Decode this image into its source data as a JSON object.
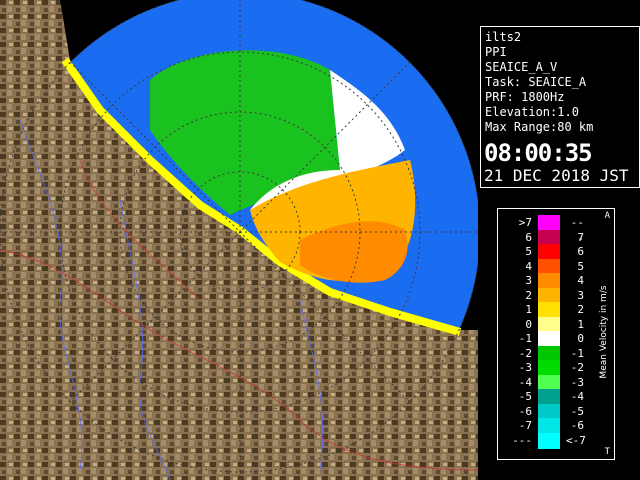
{
  "info": {
    "line1": "ilts2",
    "line2": "PPI",
    "line3": "SEAICE_A_V",
    "line4": "Task: SEAICE_A",
    "line5": "PRF: 1800Hz",
    "line6": "Elevation:1.0",
    "line7": "Max Range:80 km",
    "time": "08:00:35",
    "date": "21 DEC 2018 JST"
  },
  "legend": {
    "title": "Mean Velocity in m/s",
    "corner_top": "A",
    "corner_bottom": "T",
    "rows": [
      {
        "left": ">7",
        "right": "---",
        "color": "#ff00ff"
      },
      {
        "left": "6",
        "right": "7",
        "color": "#c80050"
      },
      {
        "left": "5",
        "right": "6",
        "color": "#ff0000"
      },
      {
        "left": "4",
        "right": "5",
        "color": "#ff5000"
      },
      {
        "left": "3",
        "right": "4",
        "color": "#ff8c00"
      },
      {
        "left": "2",
        "right": "3",
        "color": "#ffb400"
      },
      {
        "left": "1",
        "right": "2",
        "color": "#ffe000"
      },
      {
        "left": "0",
        "right": "1",
        "color": "#ffff8c"
      },
      {
        "left": "-1",
        "right": "0",
        "color": "#ffffff"
      },
      {
        "left": "-2",
        "right": "-1",
        "color": "#00c800"
      },
      {
        "left": "-3",
        "right": "-2",
        "color": "#00dc00"
      },
      {
        "left": "-4",
        "right": "-3",
        "color": "#50ff50"
      },
      {
        "left": "-5",
        "right": "-4",
        "color": "#00a08c"
      },
      {
        "left": "-6",
        "right": "-5",
        "color": "#00c8c8"
      },
      {
        "left": "-7",
        "right": "-6",
        "color": "#00e6e6"
      },
      {
        "left": "---",
        "right": "<-7",
        "color": "#00ffff"
      }
    ]
  }
}
